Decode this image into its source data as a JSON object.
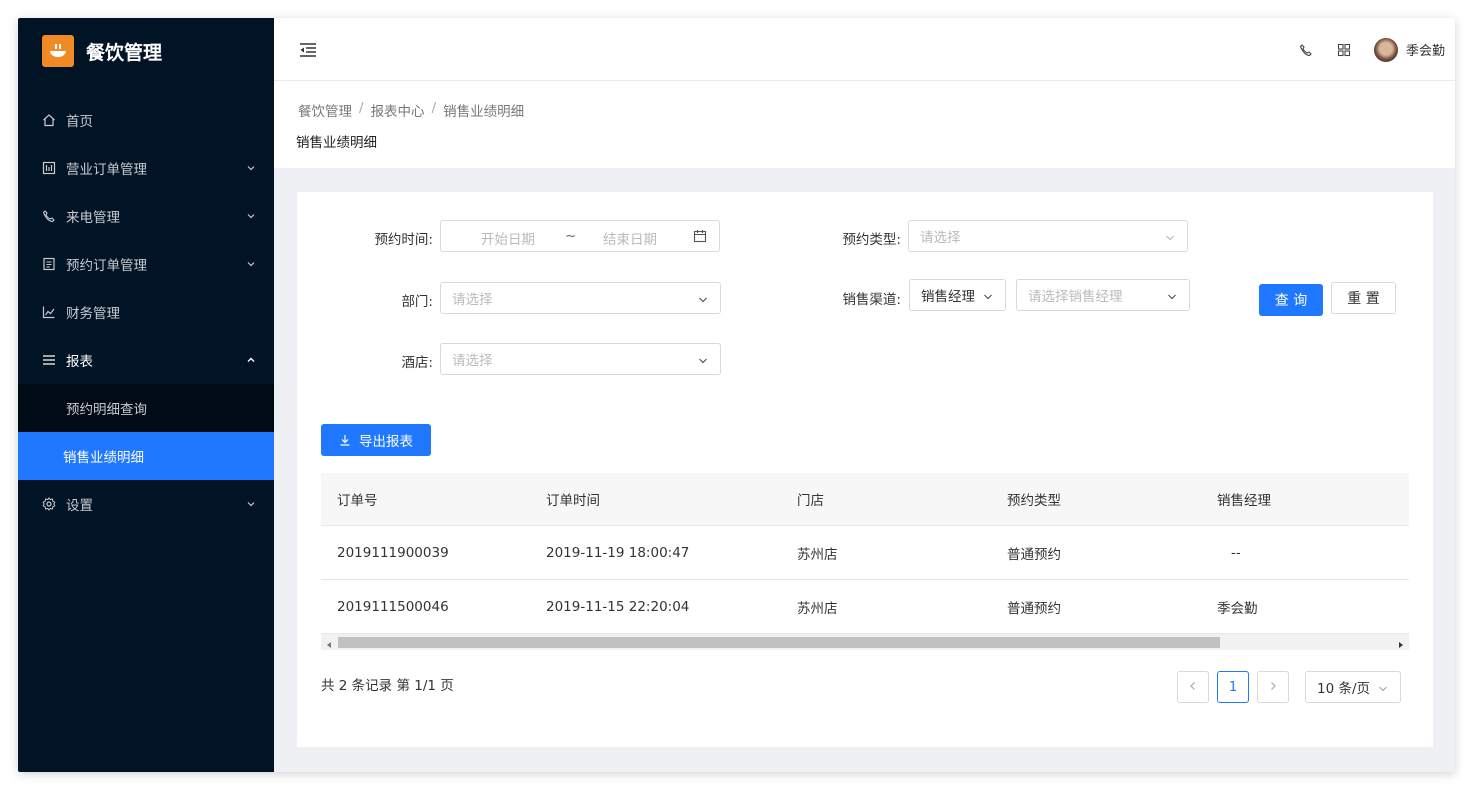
{
  "app": {
    "title": "餐饮管理"
  },
  "sidebar": {
    "items": [
      {
        "label": "首页",
        "icon": "home-icon"
      },
      {
        "label": "营业订单管理",
        "icon": "order-icon"
      },
      {
        "label": "来电管理",
        "icon": "phone-icon"
      },
      {
        "label": "预约订单管理",
        "icon": "list-icon"
      },
      {
        "label": "财务管理",
        "icon": "chart-icon"
      },
      {
        "label": "报表",
        "icon": "menu-icon"
      },
      {
        "label": "设置",
        "icon": "gear-icon"
      }
    ],
    "report_sub": [
      {
        "label": "预约明细查询"
      },
      {
        "label": "销售业绩明细"
      }
    ]
  },
  "header": {
    "username": "季会勤"
  },
  "breadcrumb": [
    "餐饮管理",
    "报表中心",
    "销售业绩明细"
  ],
  "page_title": "销售业绩明细",
  "filters": {
    "booking_time_label": "预约时间:",
    "start_placeholder": "开始日期",
    "date_sep": "~",
    "end_placeholder": "结束日期",
    "booking_type_label": "预约类型:",
    "booking_type_placeholder": "请选择",
    "dept_label": "部门:",
    "dept_placeholder": "请选择",
    "channel_label": "销售渠道:",
    "channel_value": "销售经理",
    "manager_placeholder": "请选择销售经理",
    "hotel_label": "酒店:",
    "hotel_placeholder": "请选择",
    "query_label": "查 询",
    "reset_label": "重 置"
  },
  "export_label": "导出报表",
  "table": {
    "headers": [
      "订单号",
      "订单时间",
      "门店",
      "预约类型",
      "销售经理"
    ],
    "rows": [
      [
        "2019111900039",
        "2019-11-19 18:00:47",
        "苏州店",
        "普通预约",
        "--"
      ],
      [
        "2019111500046",
        "2019-11-15 22:20:04",
        "苏州店",
        "普通预约",
        "季会勤"
      ]
    ]
  },
  "pagination": {
    "summary": "共 2 条记录 第 1/1 页",
    "current": "1",
    "page_size": "10 条/页"
  },
  "colors": {
    "primary": "#1f78ff",
    "sidebar_bg": "#001426",
    "brand_accent": "#f08a24"
  }
}
